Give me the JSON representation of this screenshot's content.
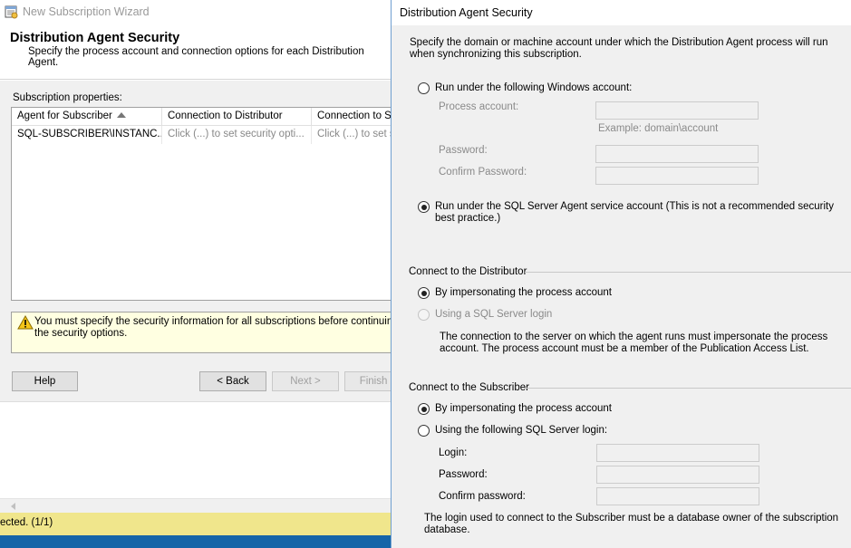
{
  "wizard": {
    "title": "New Subscription Wizard",
    "header": {
      "title": "Distribution Agent Security",
      "subtitle": "Specify the process account and connection options for each Distribution Agent."
    },
    "subscription_properties_label": "Subscription properties:",
    "grid": {
      "columns": [
        "Agent for Subscriber",
        "Connection to Distributor",
        "Connection to Su"
      ],
      "rows": [
        [
          "SQL-SUBSCRIBER\\INSTANC...",
          "Click (...) to set security opti...",
          "Click (...) to set s"
        ]
      ]
    },
    "warning": "You must specify the security information for all subscriptions before continuing the w\nthe security options.",
    "buttons": {
      "help": "Help",
      "back": "< Back",
      "next": "Next >",
      "finish": "Finish >"
    },
    "status_text": "ected. (1/1)"
  },
  "dialog": {
    "title": "Distribution Agent Security",
    "intro": "Specify the domain or machine account under which the Distribution Agent process will run when synchronizing this subscription.",
    "process_account_section": {
      "windows_account_option": "Run under the following Windows account:",
      "process_account_label": "Process account:",
      "process_account_value": "",
      "example": "Example: domain\\account",
      "password_label": "Password:",
      "password_value": "",
      "confirm_password_label": "Confirm Password:",
      "confirm_password_value": "",
      "sql_agent_option": "Run under the SQL Server Agent service account (This is not a recommended security best practice.)",
      "selected": "sql_agent"
    },
    "distributor_section": {
      "title": "Connect to the Distributor",
      "impersonate_option": "By impersonating the process account",
      "sql_login_option": "Using a SQL Server login",
      "note": "The connection to the server on which the agent runs must impersonate the process account. The process account must be a member of the Publication Access List.",
      "selected": "impersonate"
    },
    "subscriber_section": {
      "title": "Connect to the Subscriber",
      "impersonate_option": "By impersonating the process account",
      "sql_login_option": "Using the following SQL Server login:",
      "login_label": "Login:",
      "login_value": "",
      "password_label": "Password:",
      "password_value": "",
      "confirm_password_label": "Confirm password:",
      "confirm_password_value": "",
      "note": "The login used to connect to the Subscriber must be a database owner of the subscription database.",
      "selected": "impersonate"
    }
  },
  "colors": {
    "warning_bg": "#ffffe1",
    "status_bg": "#f0e68c",
    "taskbar": "#1565a8",
    "dialog_border": "#6f9fd0"
  },
  "icons": [
    "wizard-app-icon",
    "warning-icon",
    "sort-ascending-icon",
    "scroll-left-arrow-icon"
  ]
}
